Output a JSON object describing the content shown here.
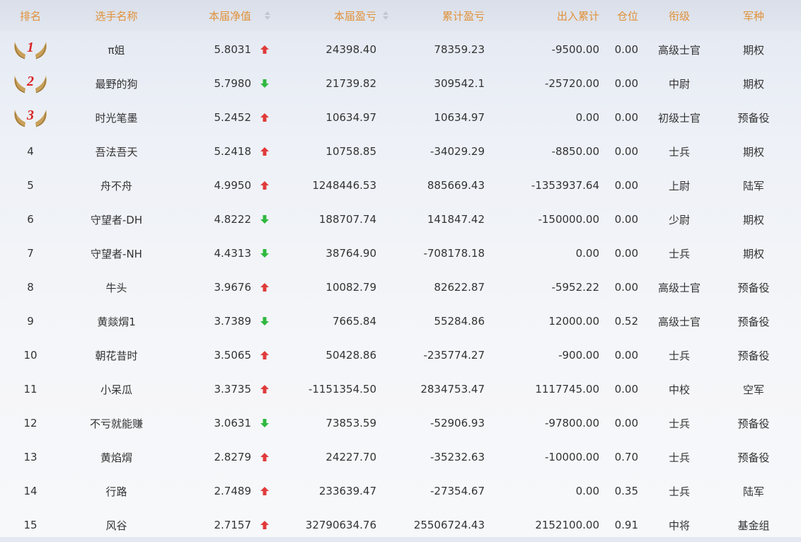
{
  "headers": {
    "rank": "排名",
    "name": "选手名称",
    "nav": "本届净值",
    "pl": "本届盈亏",
    "cum": "累计盈亏",
    "flow": "出入累计",
    "pos": "仓位",
    "title": "衔级",
    "arm": "军种"
  },
  "colors": {
    "header_text": "#e0913a",
    "up": "#e03a3a",
    "down": "#2fb83f",
    "medal_number": "#d92323"
  },
  "rows": [
    {
      "rank": "1",
      "medal": true,
      "name": "π姐",
      "nav": "5.8031",
      "trend": "up",
      "pl": "24398.40",
      "cum": "78359.23",
      "flow": "-9500.00",
      "pos": "0.00",
      "title": "高级士官",
      "arm": "期权"
    },
    {
      "rank": "2",
      "medal": true,
      "name": "最野的狗",
      "nav": "5.7980",
      "trend": "down",
      "pl": "21739.82",
      "cum": "309542.1",
      "flow": "-25720.00",
      "pos": "0.00",
      "title": "中尉",
      "arm": "期权"
    },
    {
      "rank": "3",
      "medal": true,
      "name": "时光笔墨",
      "nav": "5.2452",
      "trend": "up",
      "pl": "10634.97",
      "cum": "10634.97",
      "flow": "0.00",
      "pos": "0.00",
      "title": "初级士官",
      "arm": "预备役"
    },
    {
      "rank": "4",
      "name": "吾法吾天",
      "nav": "5.2418",
      "trend": "up",
      "pl": "10758.85",
      "cum": "-34029.29",
      "flow": "-8850.00",
      "pos": "0.00",
      "title": "士兵",
      "arm": "期权"
    },
    {
      "rank": "5",
      "name": "舟不舟",
      "nav": "4.9950",
      "trend": "up",
      "pl": "1248446.53",
      "cum": "885669.43",
      "flow": "-1353937.64",
      "pos": "0.00",
      "title": "上尉",
      "arm": "陆军"
    },
    {
      "rank": "6",
      "name": "守望者-DH",
      "nav": "4.8222",
      "trend": "down",
      "pl": "188707.74",
      "cum": "141847.42",
      "flow": "-150000.00",
      "pos": "0.00",
      "title": "少尉",
      "arm": "期权"
    },
    {
      "rank": "7",
      "name": "守望者-NH",
      "nav": "4.4313",
      "trend": "down",
      "pl": "38764.90",
      "cum": "-708178.18",
      "flow": "0.00",
      "pos": "0.00",
      "title": "士兵",
      "arm": "期权"
    },
    {
      "rank": "8",
      "name": "牛头",
      "nav": "3.9676",
      "trend": "up",
      "pl": "10082.79",
      "cum": "82622.87",
      "flow": "-5952.22",
      "pos": "0.00",
      "title": "高级士官",
      "arm": "预备役"
    },
    {
      "rank": "9",
      "name": "黄燚焨1",
      "nav": "3.7389",
      "trend": "down",
      "pl": "7665.84",
      "cum": "55284.86",
      "flow": "12000.00",
      "pos": "0.52",
      "title": "高级士官",
      "arm": "预备役"
    },
    {
      "rank": "10",
      "name": "朝花昔时",
      "nav": "3.5065",
      "trend": "up",
      "pl": "50428.86",
      "cum": "-235774.27",
      "flow": "-900.00",
      "pos": "0.00",
      "title": "士兵",
      "arm": "预备役"
    },
    {
      "rank": "11",
      "name": "小呆瓜",
      "nav": "3.3735",
      "trend": "up",
      "pl": "-1151354.50",
      "cum": "2834753.47",
      "flow": "1117745.00",
      "pos": "0.00",
      "title": "中校",
      "arm": "空军"
    },
    {
      "rank": "12",
      "name": "不亏就能赚",
      "nav": "3.0631",
      "trend": "down",
      "pl": "73853.59",
      "cum": "-52906.93",
      "flow": "-97800.00",
      "pos": "0.00",
      "title": "士兵",
      "arm": "预备役"
    },
    {
      "rank": "13",
      "name": "黄焰焨",
      "nav": "2.8279",
      "trend": "up",
      "pl": "24227.70",
      "cum": "-35232.63",
      "flow": "-10000.00",
      "pos": "0.70",
      "title": "士兵",
      "arm": "预备役"
    },
    {
      "rank": "14",
      "name": "行路",
      "nav": "2.7489",
      "trend": "up",
      "pl": "233639.47",
      "cum": "-27354.67",
      "flow": "0.00",
      "pos": "0.35",
      "title": "士兵",
      "arm": "陆军"
    },
    {
      "rank": "15",
      "name": "风谷",
      "nav": "2.7157",
      "trend": "up",
      "pl": "32790634.76",
      "cum": "25506724.43",
      "flow": "2152100.00",
      "pos": "0.91",
      "title": "中将",
      "arm": "基金组"
    }
  ]
}
